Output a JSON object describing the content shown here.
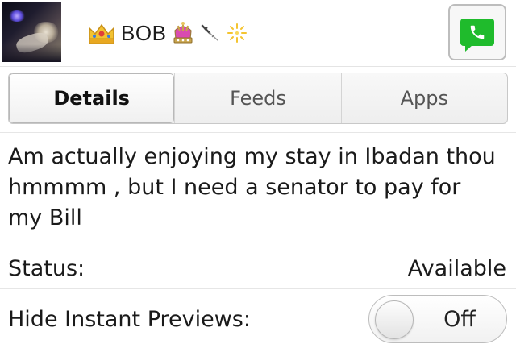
{
  "header": {
    "contact_name": "BOB",
    "icons": [
      "crown-icon",
      "ornate-crown-icon",
      "needle-icon",
      "sparkle-icon",
      "call-icon"
    ],
    "colors": {
      "call_button": "#1fbb2c"
    }
  },
  "tabs": [
    {
      "label": "Details",
      "active": true
    },
    {
      "label": "Feeds",
      "active": false
    },
    {
      "label": "Apps",
      "active": false
    }
  ],
  "status_message": "Am actually enjoying my stay in Ibadan thou hmmmm , but I need a senator to pay for my Bill",
  "fields": {
    "status": {
      "label": "Status:",
      "value": "Available"
    },
    "hide_previews": {
      "label": "Hide Instant Previews:",
      "toggle_value": "Off",
      "enabled": false
    }
  }
}
